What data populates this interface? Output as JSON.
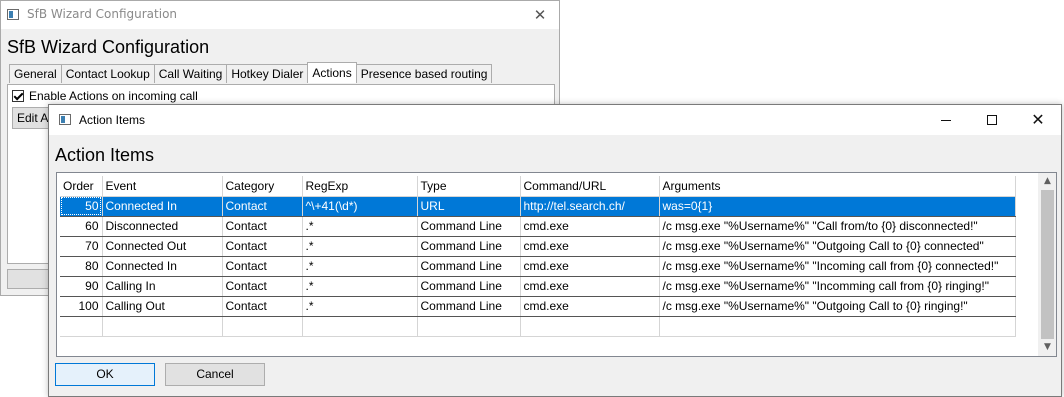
{
  "bg_window": {
    "title": "SfB Wizard Configuration",
    "heading": "SfB Wizard Configuration",
    "tabs": [
      "General",
      "Contact Lookup",
      "Call Waiting",
      "Hotkey Dialer",
      "Actions",
      "Presence based routing"
    ],
    "active_tab": "Actions",
    "enable_actions_label": "Enable Actions on incoming call",
    "enable_actions_checked": true,
    "edit_button_label": "Edit Actions..."
  },
  "dialog": {
    "title": "Action Items",
    "heading": "Action Items",
    "columns": [
      "Order",
      "Event",
      "Category",
      "RegExp",
      "Type",
      "Command/URL",
      "Arguments"
    ],
    "rows": [
      {
        "order": "50",
        "event": "Connected In",
        "category": "Contact",
        "regexp": "^\\+41(\\d*)",
        "type": "URL",
        "command": "http://tel.search.ch/",
        "arguments": "was=0{1}"
      },
      {
        "order": "60",
        "event": "Disconnected",
        "category": "Contact",
        "regexp": ".*",
        "type": "Command Line",
        "command": "cmd.exe",
        "arguments": "/c msg.exe \"%Username%\" \"Call from/to {0} disconnected!\""
      },
      {
        "order": "70",
        "event": "Connected Out",
        "category": "Contact",
        "regexp": ".*",
        "type": "Command Line",
        "command": "cmd.exe",
        "arguments": "/c msg.exe \"%Username%\" \"Outgoing Call to {0} connected\""
      },
      {
        "order": "80",
        "event": "Connected In",
        "category": "Contact",
        "regexp": ".*",
        "type": "Command Line",
        "command": "cmd.exe",
        "arguments": "/c msg.exe \"%Username%\" \"Incoming call from {0} connected!\""
      },
      {
        "order": "90",
        "event": "Calling In",
        "category": "Contact",
        "regexp": ".*",
        "type": "Command Line",
        "command": "cmd.exe",
        "arguments": "/c msg.exe \"%Username%\" \"Incomming call from {0} ringing!\""
      },
      {
        "order": "100",
        "event": "Calling Out",
        "category": "Contact",
        "regexp": ".*",
        "type": "Command Line",
        "command": "cmd.exe",
        "arguments": "/c msg.exe \"%Username%\" \"Outgoing Call to {0} ringing!\""
      }
    ],
    "selected_row": 0,
    "ok_label": "OK",
    "cancel_label": "Cancel"
  },
  "colors": {
    "selection": "#0078d7",
    "window_bg": "#f0f0f0"
  }
}
